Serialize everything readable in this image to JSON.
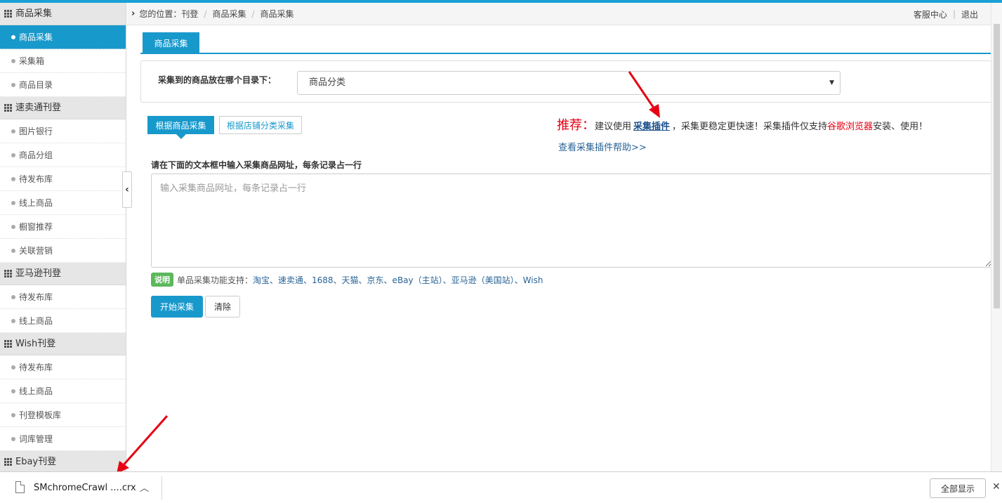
{
  "sidebar": {
    "groups": [
      {
        "title": "商品采集",
        "items": [
          "商品采集",
          "采集箱",
          "商品目录"
        ]
      },
      {
        "title": "速卖通刊登",
        "items": [
          "图片银行",
          "商品分组",
          "待发布库",
          "线上商品",
          "橱窗推荐",
          "关联营销"
        ]
      },
      {
        "title": "亚马逊刊登",
        "items": [
          "待发布库",
          "线上商品"
        ]
      },
      {
        "title": "Wish刊登",
        "items": [
          "待发布库",
          "线上商品",
          "刊登模板库",
          "词库管理"
        ]
      },
      {
        "title": "Ebay刊登",
        "items": []
      }
    ],
    "active_item": "商品采集"
  },
  "breadcrumb": {
    "prefix": "您的位置：",
    "items": [
      "刊登",
      "商品采集",
      "商品采集"
    ],
    "customer_service": "客服中心",
    "logout": "退出"
  },
  "tabs": {
    "active": "商品采集"
  },
  "directory": {
    "label": "采集到的商品放在哪个目录下：",
    "selected": "商品分类"
  },
  "modes": {
    "by_product": "根据商品采集",
    "by_store": "根据店铺分类采集"
  },
  "recommend": {
    "title": "推荐：",
    "text1": "建议使用",
    "plugin": "采集插件",
    "text2": "，采集更稳定更快速！采集插件仅支持",
    "browser": "谷歌浏览器",
    "text3": " 安装、使用！",
    "help": "查看采集插件帮助>>"
  },
  "input": {
    "label": "请在下面的文本框中输入采集商品网址，每条记录占一行",
    "placeholder": "输入采集商品网址，每条记录占一行",
    "value": ""
  },
  "note": {
    "badge": "说明",
    "prefix": "单品采集功能支持：",
    "sites": "淘宝、速卖通、1688、天猫、京东、eBay（主站）、亚马逊（美国站）、Wish"
  },
  "buttons": {
    "start": "开始采集",
    "clear": "清除"
  },
  "download_bar": {
    "file": "SMchromeCrawl ....crx",
    "show_all": "全部显示",
    "close": "✕"
  },
  "colors": {
    "accent": "#1899cc",
    "warning_red": "#e60012",
    "badge_green": "#5cb85c"
  }
}
